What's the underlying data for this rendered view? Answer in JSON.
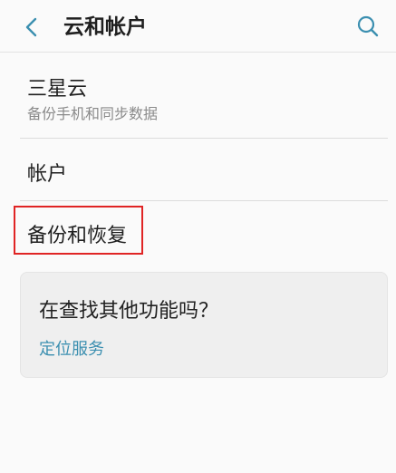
{
  "header": {
    "title": "云和帐户",
    "accent_color": "#3b8fb0"
  },
  "list": {
    "cloud": {
      "title": "三星云",
      "subtitle": "备份手机和同步数据"
    },
    "account": {
      "title": "帐户"
    },
    "backup": {
      "title": "备份和恢复"
    }
  },
  "suggestion": {
    "title": "在查找其他功能吗？",
    "link": "定位服务"
  },
  "icons": {
    "back": "chevron-left-icon",
    "search": "search-icon"
  },
  "colors": {
    "highlight": "#e02424",
    "link": "#3b8fb0"
  }
}
